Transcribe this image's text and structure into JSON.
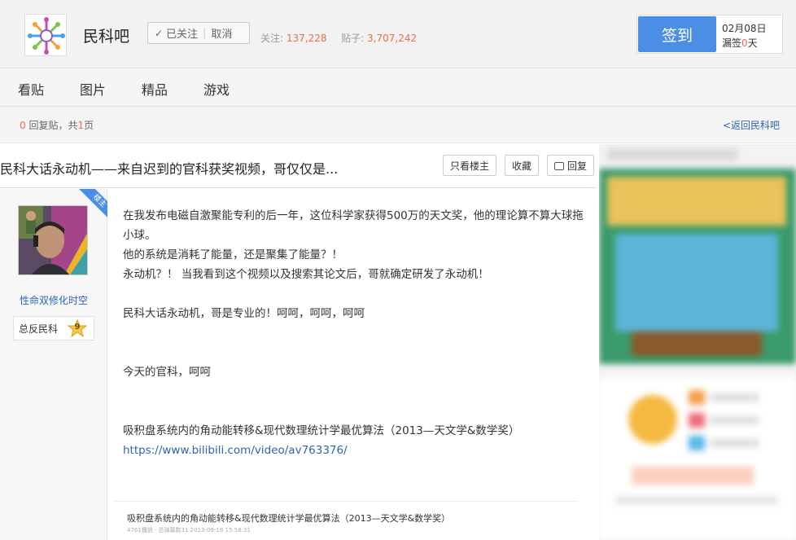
{
  "header": {
    "forum_name": "民科吧",
    "follow_label": "已关注",
    "unfollow_label": "取消",
    "followers_label": "关注:",
    "followers": "137,228",
    "posts_label": "贴子:",
    "posts": "3,707,242",
    "signin_label": "签到",
    "date": "02月08日",
    "missed_prefix": "漏签",
    "missed_count": "0",
    "missed_suffix": "天"
  },
  "nav": {
    "items": [
      {
        "label": "看贴"
      },
      {
        "label": "图片"
      },
      {
        "label": "精品"
      },
      {
        "label": "游戏"
      }
    ]
  },
  "infobar": {
    "reply_count": "0",
    "reply_label": "回复贴，共",
    "pages": "1",
    "pages_suffix": "页",
    "back_link": "<返回民科吧"
  },
  "thread": {
    "title": "民科大话永动机——来自迟到的官科获奖视频，哥仅仅是...",
    "buttons": {
      "only_op": "只看楼主",
      "favorite": "收藏",
      "reply": "回复"
    }
  },
  "author": {
    "badge": "楼主",
    "name": "性命双修化时空",
    "level_name": "总反民科",
    "level": "9"
  },
  "post": {
    "line1": "在我发布电磁自激聚能专利的后一年，这位科学家获得500万的天文奖，他的理论算不算大球拖小球。",
    "line2": "他的系统是消耗了能量，还是聚集了能量？！",
    "line3": "永动机？！ 当我看到这个视频以及搜索其论文后，哥就确定研发了永动机！",
    "line4": "民科大话永动机，哥是专业的！呵呵，呵呵，呵呵",
    "line5": "今天的官科，呵呵",
    "line6": "吸积盘系统内的角动能转移&现代数理统计学最优算法（2013—天文学&数学奖）",
    "link": "https://www.bilibili.com/video/av763376/",
    "preview_title": "吸积盘系统内的角动能转移&现代数理统计学最优算法（2013—天文学&数学奖）",
    "preview_meta": "4761播放 · 总弹幕数31   2013-09-16 15:58:31"
  }
}
